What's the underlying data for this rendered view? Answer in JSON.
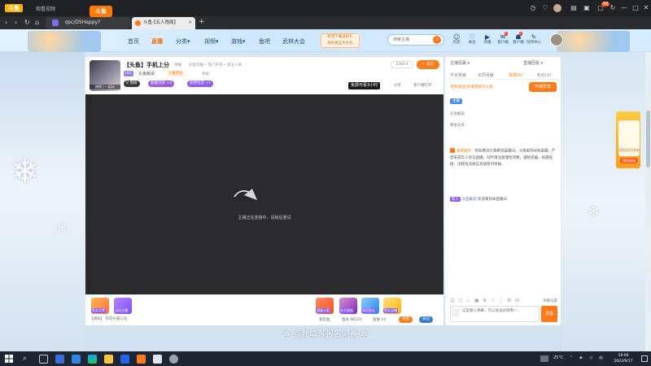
{
  "browser": {
    "logo": "斗鱼",
    "window_title": "观看视频",
    "address": "qsc/D5Happy?rid=4768139",
    "tab_title": "斗鱼·【五人残局】",
    "new_tab": "+"
  },
  "header": {
    "site_logo": "斗鱼",
    "nav": [
      "首页",
      "直播",
      "分类▾",
      "视频▾",
      "游戏▾",
      "鱼吧",
      "武林大会"
    ],
    "promo_line1": "新游下载送好礼",
    "promo_line2": "你的爱豆大礼包",
    "search_placeholder": "搜索主播",
    "icons": [
      {
        "glyph": "☺",
        "label": "历史"
      },
      {
        "glyph": "♡",
        "label": "关注"
      },
      {
        "glyph": "▶",
        "label": "开播"
      },
      {
        "glyph": "✉",
        "label": "客户端"
      },
      {
        "glyph": "☗",
        "label": "客户端"
      },
      {
        "glyph": "✎",
        "label": "创作中心"
      }
    ],
    "badges": [
      "!",
      "!"
    ]
  },
  "room": {
    "title": "【头鱼】手机上分",
    "category": "举报",
    "breadcrumb": "彩蛋优雅 • 热门手游 • 第五人格",
    "level": "LV1",
    "nickname": "头鱼解说",
    "owner_tag": "1 推荐位",
    "report": "举报",
    "pills": [
      {
        "text": "V 周榜",
        "color": "#3a3a3a"
      },
      {
        "text": "超能玩具 +4",
        "color": "#9b5de5"
      },
      {
        "text": "超燃电音 +1",
        "color": "#8b5cf6"
      }
    ],
    "room_id": "2360 ▾",
    "follow": "+ 关注",
    "free_watch": "免费可看3小时",
    "share": "分享",
    "client": "客户端打开",
    "streamer_tag": "热榜 | 一起玩",
    "video_message": "主播正在连接中，请稍后重试"
  },
  "gifts": {
    "items": [
      "鱼丸打赏",
      "送给主播",
      "超级火箭",
      "办卡送礼",
      "网页鱼丸",
      "鱼丸宝箱"
    ],
    "sub_left": "【通知】 欢迎光临斗鱼",
    "info": [
      "爱玩鱼",
      "鱼丸 96220",
      "鱼翅 14"
    ],
    "btn_recharge": "充值",
    "btn_gift": "背包"
  },
  "chat": {
    "top_left": "主播招募 ▾",
    "top_right": "直播回看 ▾",
    "tabs": [
      "今日贡献",
      "本周贡献",
      "贵宾(0)",
      "粉丝(0)"
    ],
    "rank_row": "贵宾/粉丝/开通贵宾可入座",
    "open_guard": "开通贵宾",
    "badge": "主播",
    "lines": [
      "头鱼解说",
      "静坐众多"
    ],
    "sys_label": "系统提示：",
    "sys_text": "欢迎来到头鱼解说直播间。斗鱼倡导绿色直播，严禁未成年人参与直播，同时请注意理性消费，谨防诈骗，如遇低俗、涉政等违规信息请及时举报。",
    "welcome_badge": "新人",
    "welcome_name": "头鱼解说",
    "welcome_text": "欢迎来到本直播间",
    "danmu_settings": "弹幕设置",
    "input_placeholder": "这里输入弹幕，可以发送表情哦～",
    "send": "发送"
  },
  "banner_text": "✻ 点我填写报名问卷 ✻",
  "float_ad": {
    "line1": "10月12日开启",
    "btn": "预约参加"
  },
  "taskbar": {
    "temp": "25°C",
    "ime": "中",
    "time": "19:00",
    "date": "2022/9/17"
  }
}
